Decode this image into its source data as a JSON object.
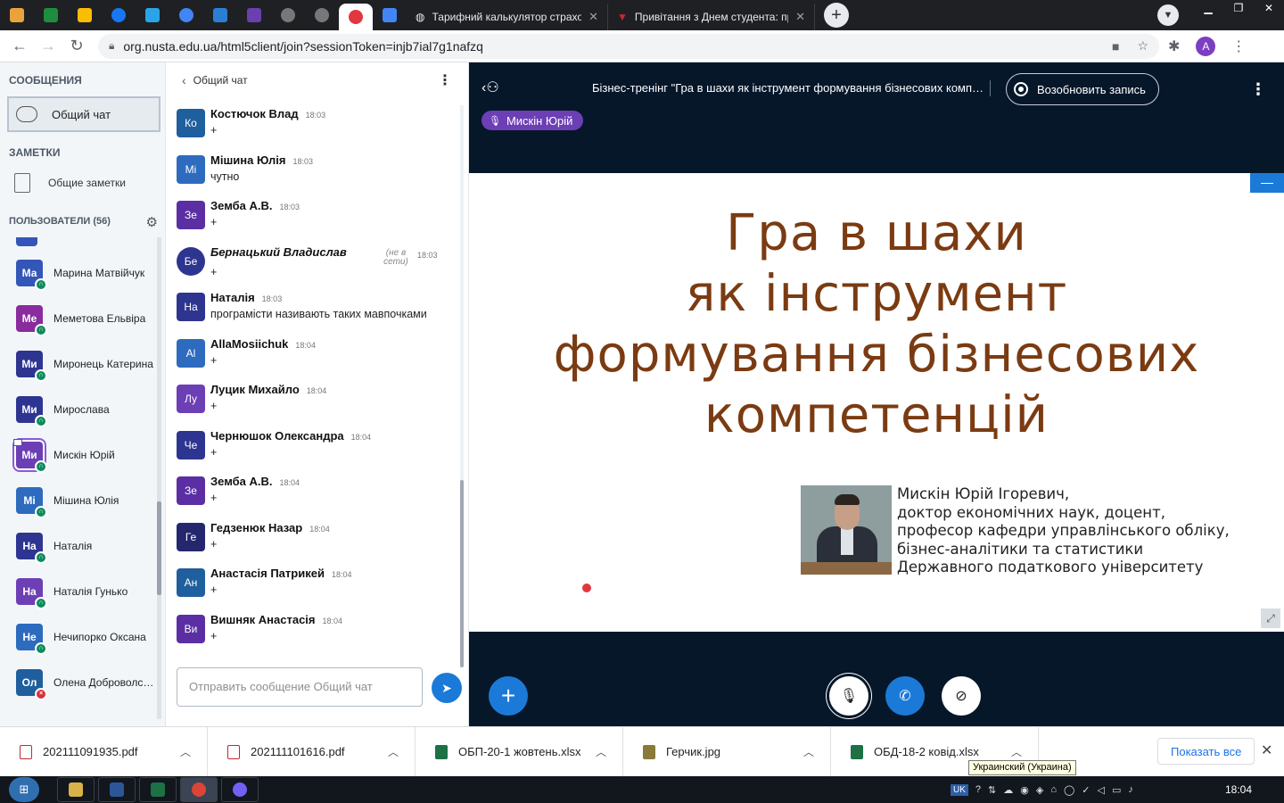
{
  "browser": {
    "tabs": [
      {
        "title": "Тарифний калькулятор страхові"
      },
      {
        "title": "Привітання з Днем студента: пр"
      }
    ],
    "url": "org.nusta.edu.ua/html5client/join?sessionToken=injb7ial7g1nafzq",
    "profile_initial": "A"
  },
  "sidebar": {
    "messages_title": "СООБЩЕНИЯ",
    "public_chat_label": "Общий чат",
    "notes_title": "ЗАМЕТКИ",
    "shared_notes_label": "Общие заметки",
    "users_title": "ПОЛЬЗОВАТЕЛИ (56)",
    "users": [
      {
        "initials": "Ма",
        "name": "Марина Матвійчук",
        "color": "#3456b8",
        "status": "listen"
      },
      {
        "initials": "Ме",
        "name": "Меметова Ельвіра",
        "color": "#8a2b9e",
        "status": "listen"
      },
      {
        "initials": "Ми",
        "name": "Миронець Катерина",
        "color": "#2e3590",
        "status": "listen"
      },
      {
        "initials": "Ми",
        "name": "Мирослава",
        "color": "#2e3590",
        "status": "listen"
      },
      {
        "initials": "Ми",
        "name": "Мискін Юрій",
        "color": "#6c3fb5",
        "status": "listen",
        "presenter": true
      },
      {
        "initials": "Мі",
        "name": "Мішина Юлія",
        "color": "#2d6bbf",
        "status": "listen"
      },
      {
        "initials": "На",
        "name": "Наталія",
        "color": "#2e3590",
        "status": "listen"
      },
      {
        "initials": "На",
        "name": "Наталія Гунько",
        "color": "#6c3fb5",
        "status": "listen"
      },
      {
        "initials": "Не",
        "name": "Нечипорко Оксана",
        "color": "#2d6bbf",
        "status": "listen"
      },
      {
        "initials": "Ол",
        "name": "Олена Доброволська",
        "color": "#1f5f9e",
        "status": "muted"
      }
    ]
  },
  "chat": {
    "header": "Общий чат",
    "messages": [
      {
        "initials": "Ко",
        "name": "Костючок Влад",
        "time": "18:03",
        "text": "+",
        "color": "#1f5f9e"
      },
      {
        "initials": "Мі",
        "name": "Мішина Юлія",
        "time": "18:03",
        "text": "чутно",
        "color": "#2d6bbf"
      },
      {
        "initials": "Зе",
        "name": "Земба А.В.",
        "time": "18:03",
        "text": "+",
        "color": "#5b2fa3"
      },
      {
        "initials": "Бе",
        "name": "Бернацький Владислав",
        "time": "18:03",
        "text": "+",
        "color": "#2e3590",
        "offline": "(не в сети)"
      },
      {
        "initials": "На",
        "name": "Наталія",
        "time": "18:03",
        "text": "програмісти називають таких мавпочками",
        "color": "#2e3590"
      },
      {
        "initials": "Al",
        "name": "AllaMosiichuk",
        "time": "18:04",
        "text": "+",
        "color": "#2d6bbf"
      },
      {
        "initials": "Лу",
        "name": "Луцик Михайло",
        "time": "18:04",
        "text": "+",
        "color": "#6c3fb5"
      },
      {
        "initials": "Че",
        "name": "Чернюшок Олександра",
        "time": "18:04",
        "text": "+",
        "color": "#2e3590"
      },
      {
        "initials": "Зе",
        "name": "Земба А.В.",
        "time": "18:04",
        "text": "+",
        "color": "#5b2fa3"
      },
      {
        "initials": "Ге",
        "name": "Гедзенюк Назар",
        "time": "18:04",
        "text": "+",
        "color": "#24276e"
      },
      {
        "initials": "Ан",
        "name": "Анастасія Патрикей",
        "time": "18:04",
        "text": "+",
        "color": "#1f5f9e"
      },
      {
        "initials": "Ви",
        "name": "Вишняк Анастасія",
        "time": "18:04",
        "text": "+",
        "color": "#5b2fa3"
      }
    ],
    "input_placeholder": "Отправить сообщение Общий чат"
  },
  "meeting": {
    "title": "Бізнес-тренінг \"Гра в шахи як інструмент формування бізнесових компетенцій\"",
    "record_label": "Возобновить запись",
    "talking": "Мискін Юрій"
  },
  "slide": {
    "title_lines": [
      "Гра в шахи",
      "як інструмент",
      "формування бізнесових",
      "компетенцій"
    ],
    "author_lines": [
      "Мискін Юрій Ігоревич,",
      "доктор економічних наук, доцент,",
      "професор кафедри управлінського обліку,",
      "бізнес-аналітики та статистики",
      "Державного податкового університету"
    ]
  },
  "downloads": {
    "items": [
      {
        "name": "202111091935.pdf",
        "type": "pdf"
      },
      {
        "name": "202111101616.pdf",
        "type": "pdf"
      },
      {
        "name": "ОБП-20-1 жовтень.xlsx",
        "type": "xlsx"
      },
      {
        "name": "Герчик.jpg",
        "type": "jpg"
      },
      {
        "name": "ОБД-18-2 ковід.xlsx",
        "type": "xlsx"
      }
    ],
    "show_all": "Показать все"
  },
  "taskbar": {
    "tooltip": "Украинский (Украина)",
    "lang": "UK",
    "clock": "18:04"
  },
  "colors": {
    "accent": "#1b7ad8",
    "meeting_bg": "#06172a",
    "slide_title": "#7b3b12",
    "talker": "#6c3fb5"
  }
}
